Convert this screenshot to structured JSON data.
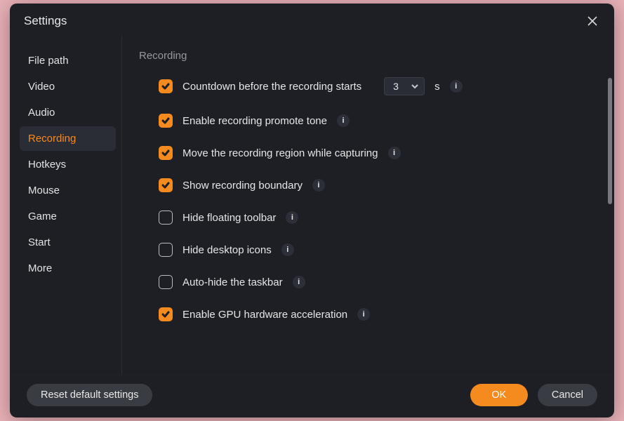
{
  "header": {
    "title": "Settings"
  },
  "sidebar": {
    "items": [
      {
        "label": "File path",
        "active": false
      },
      {
        "label": "Video",
        "active": false
      },
      {
        "label": "Audio",
        "active": false
      },
      {
        "label": "Recording",
        "active": true
      },
      {
        "label": "Hotkeys",
        "active": false
      },
      {
        "label": "Mouse",
        "active": false
      },
      {
        "label": "Game",
        "active": false
      },
      {
        "label": "Start",
        "active": false
      },
      {
        "label": "More",
        "active": false
      }
    ]
  },
  "content": {
    "section_title": "Recording",
    "countdown_unit": "s",
    "countdown_value": "3",
    "options": [
      {
        "label": "Countdown before the recording starts",
        "checked": true,
        "has_select": true,
        "has_info": true
      },
      {
        "label": "Enable recording promote tone",
        "checked": true,
        "has_select": false,
        "has_info": true
      },
      {
        "label": "Move the recording region while capturing",
        "checked": true,
        "has_select": false,
        "has_info": true
      },
      {
        "label": "Show recording boundary",
        "checked": true,
        "has_select": false,
        "has_info": true
      },
      {
        "label": "Hide floating toolbar",
        "checked": false,
        "has_select": false,
        "has_info": true
      },
      {
        "label": "Hide desktop icons",
        "checked": false,
        "has_select": false,
        "has_info": true
      },
      {
        "label": "Auto-hide the taskbar",
        "checked": false,
        "has_select": false,
        "has_info": true
      },
      {
        "label": "Enable GPU hardware acceleration",
        "checked": true,
        "has_select": false,
        "has_info": true
      }
    ]
  },
  "footer": {
    "reset_label": "Reset default settings",
    "ok_label": "OK",
    "cancel_label": "Cancel"
  }
}
